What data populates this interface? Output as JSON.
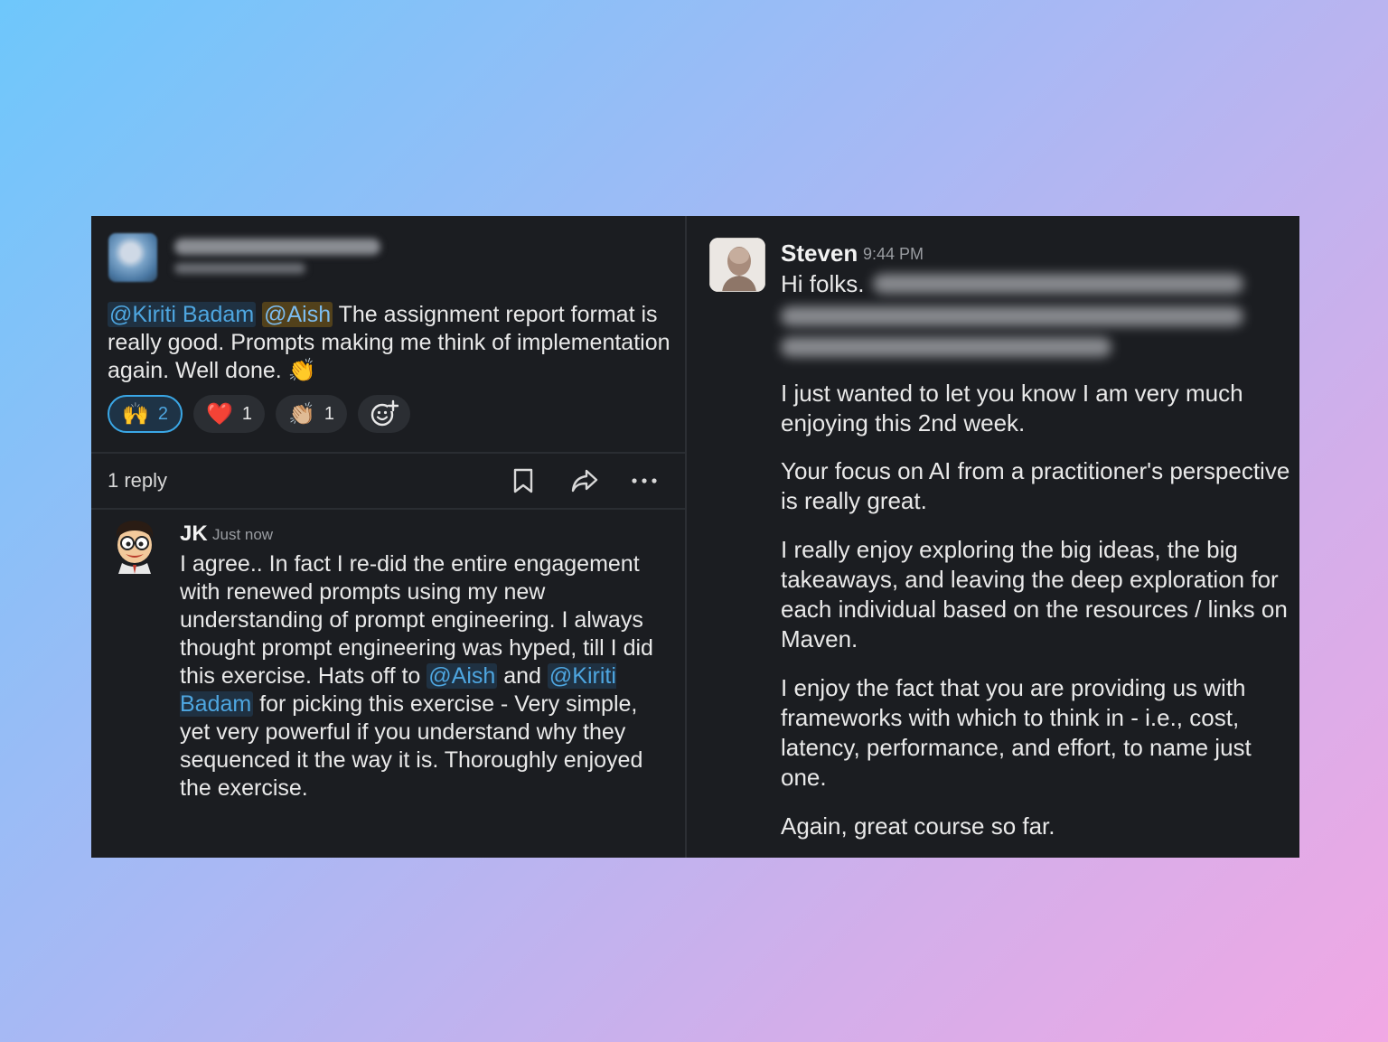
{
  "left_message": {
    "mention_1": "@Kiriti Badam",
    "mention_2": "@Aish",
    "text": " The assignment report format is really good. Prompts making me think of implementation again. Well done. ",
    "emoji": "👏",
    "reactions": [
      {
        "emoji": "🙌",
        "count": "2",
        "active": true
      },
      {
        "emoji": "❤️",
        "count": "1",
        "active": false
      },
      {
        "emoji": "👏🏼",
        "count": "1",
        "active": false
      }
    ],
    "add_reaction_icon": "add-reaction-icon",
    "reply_count": "1 reply",
    "action_icons": [
      "bookmark-icon",
      "share-icon",
      "more-icon"
    ]
  },
  "reply": {
    "author": "JK",
    "time": "Just now",
    "text_1": "I agree.. In fact I re-did the entire engagement with renewed prompts using my new understanding of prompt engineering. I always thought prompt engineering was hyped, till I did this exercise. Hats off to ",
    "mention_1": "@Aish",
    "text_2": " and ",
    "mention_2": "@Kiriti Badam",
    "text_3": " for picking this exercise - Very simple, yet very powerful if you understand why they sequenced it the way it is. Thoroughly enjoyed the exercise."
  },
  "right_message": {
    "author": "Steven",
    "time": "9:44 PM",
    "greeting": "Hi folks.",
    "paragraphs": [
      "I just wanted to let you know I am very much enjoying this 2nd week.",
      "Your focus on AI from a practitioner's perspective is really great.",
      "I really enjoy exploring the big ideas, the big takeaways, and leaving the deep exploration for each individual based on the resources / links on Maven.",
      "I enjoy the fact that you are providing us with frameworks with which to think in - i.e., cost, latency, performance, and effort, to name just one.",
      "Again, great course so far."
    ]
  },
  "colors": {
    "panel_bg": "#1b1d21",
    "mention": "#4ea6e0",
    "active_reaction_border": "#3aa7e6"
  }
}
